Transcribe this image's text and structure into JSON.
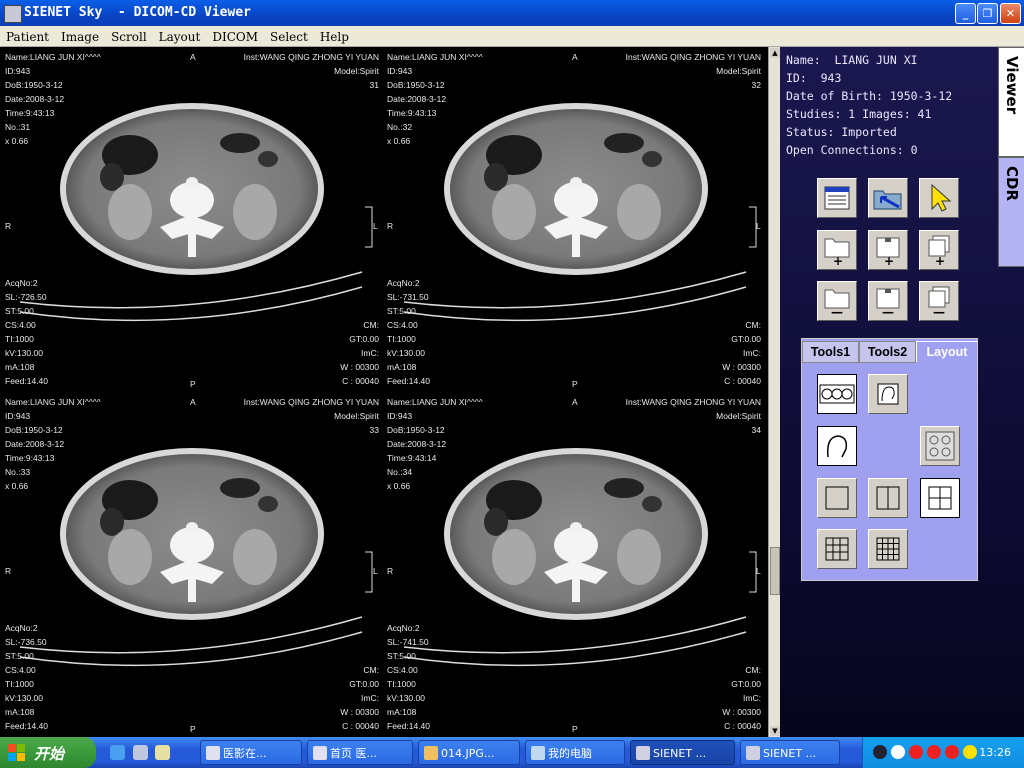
{
  "window": {
    "title": "SIENET Sky  - DICOM-CD Viewer",
    "minimize": "_",
    "maximize": "❐",
    "close": "✕"
  },
  "menu": [
    "Patient",
    "Image",
    "Scroll",
    "Layout",
    "DICOM",
    "Select",
    "Help"
  ],
  "images": [
    {
      "tl": "Name:LIANG JUN XI^^^^\nID:943\nDoB:1950-3-12\nDate:2008-3-12\nTime:9:43:13\nNo.:31\nx 0.66",
      "top": "A",
      "tr": "Inst:WANG QING ZHONG YI YUAN\nModel:Spirit\n31",
      "left": "R",
      "right": "L",
      "bl": "AcqNo:2\nSL:-726.50\nST:5.00\nCS:4.00\nTI:1000\nkV:130.00\nmA:108\nFeed:14.40",
      "br": "CM:\nGT:0.00\nImC:\nW : 00300\nC : 00040",
      "bottom": "P"
    },
    {
      "tl": "Name:LIANG JUN XI^^^^\nID:943\nDoB:1950-3-12\nDate:2008-3-12\nTime:9:43:13\nNo.:32\nx 0.66",
      "top": "A",
      "tr": "Inst:WANG QING ZHONG YI YUAN\nModel:Spirit\n32",
      "left": "R",
      "right": "L",
      "bl": "AcqNo:2\nSL:-731.50\nST:5.00\nCS:4.00\nTI:1000\nkV:130.00\nmA:108\nFeed:14.40",
      "br": "CM:\nGT:0.00\nImC:\nW : 00300\nC : 00040",
      "bottom": "P"
    },
    {
      "tl": "Name:LIANG JUN XI^^^^\nID:943\nDoB:1950-3-12\nDate:2008-3-12\nTime:9:43:13\nNo.:33\nx 0.66",
      "top": "A",
      "tr": "Inst:WANG QING ZHONG YI YUAN\nModel:Spirit\n33",
      "left": "R",
      "right": "L",
      "bl": "AcqNo:2\nSL:-736.50\nST:5.00\nCS:4.00\nTI:1000\nkV:130.00\nmA:108\nFeed:14.40",
      "br": "CM:\nGT:0.00\nImC:\nW : 00300\nC : 00040",
      "bottom": "P"
    },
    {
      "tl": "Name:LIANG JUN XI^^^^\nID:943\nDoB:1950-3-12\nDate:2008-3-12\nTime:9:43:14\nNo.:34\nx 0.66",
      "top": "A",
      "tr": "Inst:WANG QING ZHONG YI YUAN\nModel:Spirit\n34",
      "left": "R",
      "right": "L",
      "bl": "AcqNo:2\nSL:-741.50\nST:5.00\nCS:4.00\nTI:1000\nkV:130.00\nmA:108\nFeed:14.40",
      "br": "CM:\nGT:0.00\nImC:\nW : 00300\nC : 00040",
      "bottom": "P"
    }
  ],
  "patient_info": "Name:  LIANG JUN XI\nID:  943\nDate of Birth: 1950-3-12\nStudies: 1 Images: 41\nStatus: Imported\nOpen Connections: 0",
  "side_tabs": [
    "Viewer",
    "CDR"
  ],
  "tool_tabs": [
    "Tools1",
    "Tools2",
    "Layout"
  ],
  "taskbar": {
    "start": "开始",
    "tasks": [
      "医影在...",
      "首页 医...",
      "014.JPG...",
      "我的电脑",
      "SIENET ...",
      "SIENET ..."
    ],
    "clock": "13:26"
  },
  "colors": {
    "accent": "#0a5fe8",
    "tools_panel": "#a0a0f0",
    "side_bg": "#1b1850"
  }
}
